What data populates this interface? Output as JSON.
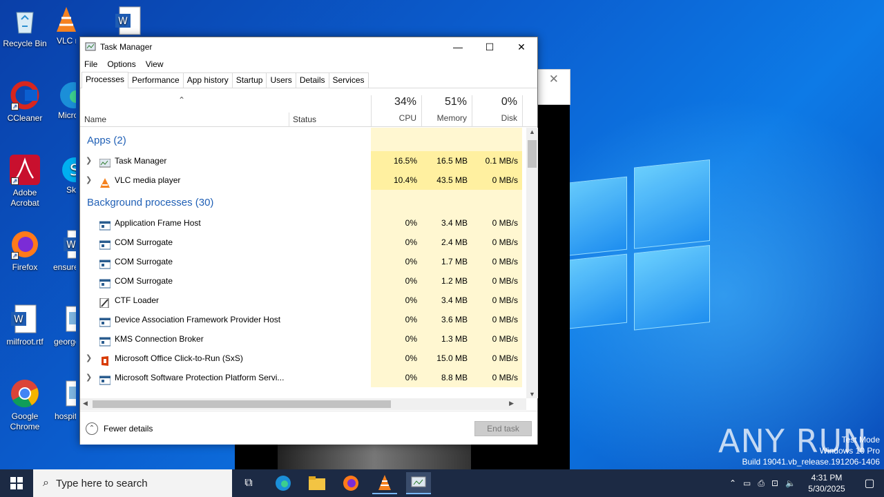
{
  "desktop": {
    "icons": [
      {
        "label": "Recycle Bin"
      },
      {
        "label": "CCleaner"
      },
      {
        "label": "Adobe Acrobat"
      },
      {
        "label": "Firefox"
      },
      {
        "label": "milfroot.rtf"
      },
      {
        "label": "Google Chrome"
      },
      {
        "label": "VLC media player"
      },
      {
        "label": "Microsoft Edge"
      },
      {
        "label": "Skype"
      },
      {
        "label": "ensurea"
      },
      {
        "label": "george"
      },
      {
        "label": "hospita"
      }
    ]
  },
  "window": {
    "title": "Task Manager",
    "menu": [
      "File",
      "Options",
      "View"
    ],
    "tabs": [
      "Processes",
      "Performance",
      "App history",
      "Startup",
      "Users",
      "Details",
      "Services"
    ]
  },
  "columns": {
    "name": "Name",
    "status": "Status",
    "cpu": {
      "pct": "34%",
      "label": "CPU"
    },
    "memory": {
      "pct": "51%",
      "label": "Memory"
    },
    "disk": {
      "pct": "0%",
      "label": "Disk"
    }
  },
  "groups": {
    "apps": "Apps (2)",
    "background": "Background processes (30)"
  },
  "apps": [
    {
      "name": "Task Manager",
      "cpu": "16.5%",
      "mem": "16.5 MB",
      "disk": "0.1 MB/s"
    },
    {
      "name": "VLC media player",
      "cpu": "10.4%",
      "mem": "43.5 MB",
      "disk": "0 MB/s"
    }
  ],
  "background": [
    {
      "name": "Application Frame Host",
      "cpu": "0%",
      "mem": "3.4 MB",
      "disk": "0 MB/s"
    },
    {
      "name": "COM Surrogate",
      "cpu": "0%",
      "mem": "2.4 MB",
      "disk": "0 MB/s"
    },
    {
      "name": "COM Surrogate",
      "cpu": "0%",
      "mem": "1.7 MB",
      "disk": "0 MB/s"
    },
    {
      "name": "COM Surrogate",
      "cpu": "0%",
      "mem": "1.2 MB",
      "disk": "0 MB/s"
    },
    {
      "name": "CTF Loader",
      "cpu": "0%",
      "mem": "3.4 MB",
      "disk": "0 MB/s"
    },
    {
      "name": "Device Association Framework Provider Host",
      "cpu": "0%",
      "mem": "3.6 MB",
      "disk": "0 MB/s"
    },
    {
      "name": "KMS Connection Broker",
      "cpu": "0%",
      "mem": "1.3 MB",
      "disk": "0 MB/s"
    },
    {
      "name": "Microsoft Office Click-to-Run (SxS)",
      "cpu": "0%",
      "mem": "15.0 MB",
      "disk": "0 MB/s"
    },
    {
      "name": "Microsoft Software Protection Platform Servi...",
      "cpu": "0%",
      "mem": "8.8 MB",
      "disk": "0 MB/s"
    }
  ],
  "footer": {
    "fewer_details": "Fewer details",
    "end_task": "End task"
  },
  "taskbar": {
    "search_placeholder": "Type here to search",
    "time": "4:31 PM",
    "date": "5/30/2025"
  },
  "watermark": {
    "brand": "ANY RUN",
    "line1": "Test Mode",
    "line2": "Windows 10 Pro",
    "line3": "Build 19041.vb_release.191206-1406"
  },
  "colors": {
    "group_text": "#1f5fb5",
    "cpu_heat_high": "#fff0a0",
    "cpu_heat_low": "#fff7d1",
    "taskbar": "#1c2a44"
  }
}
